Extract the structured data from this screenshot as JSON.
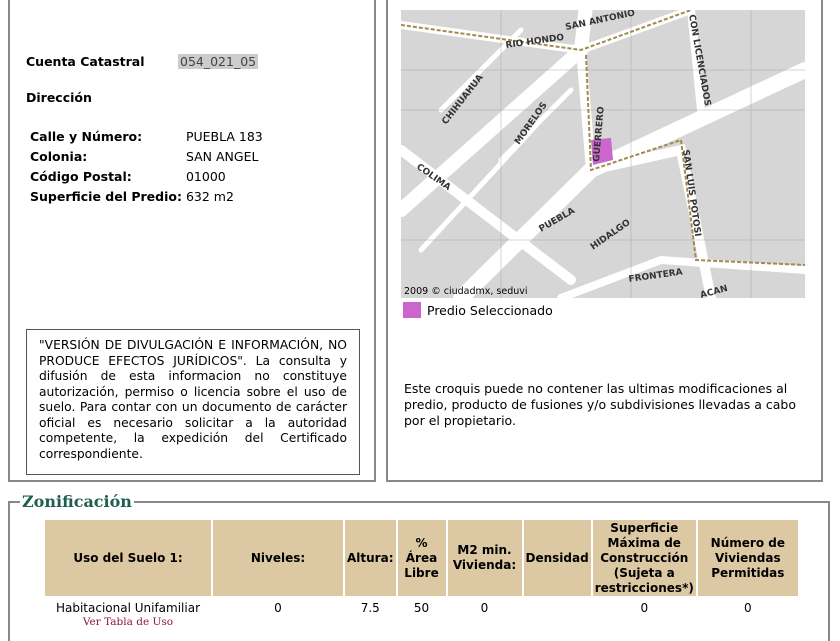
{
  "cuenta": {
    "label": "Cuenta Catastral",
    "value": "054_021_05"
  },
  "direccion": {
    "label": "Dirección",
    "rows": [
      {
        "label": "Calle y Número:",
        "value": "PUEBLA 183"
      },
      {
        "label": "Colonia:",
        "value": "SAN ANGEL"
      },
      {
        "label": "Código Postal:",
        "value": "01000"
      },
      {
        "label": "Superficie del Predio:",
        "value": "632 m2"
      }
    ]
  },
  "disclaimer": "\"VERSIÓN DE DIVULGACIÓN E INFORMACIÓN, NO PRODUCE EFECTOS JURÍDICOS\". La consulta y difusión de esta informacion no constituye autorización, permiso o licencia sobre el uso de suelo. Para contar con un documento de carácter oficial es necesario solicitar a la autoridad competente, la expedición del Certificado correspondiente.",
  "map": {
    "streets": [
      "SAN ANTONIO",
      "RIO HONDO",
      "CHIHUAHUA",
      "MORELOS",
      "GUERRERO",
      "CON LICENCIADOS",
      "COLIMA",
      "PUEBLA",
      "SAN LUIS POTOSI",
      "HIDALGO",
      "FRONTERA",
      "ACAN"
    ],
    "credit": "2009 © ciudadmx, seduvi",
    "highlight_color": "#cc66cc"
  },
  "legend": "Predio Seleccionado",
  "note": "Este croquis puede no contener las ultimas modificaciones al predio, producto de fusiones y/o subdivisiones llevadas a cabo por el propietario.",
  "zonificacion": {
    "title": "Zonificación",
    "headers": [
      "Uso del Suelo 1:",
      "Niveles:",
      "Altura:",
      "% Área Libre",
      "M2 min. Vivienda:",
      "Densidad",
      "Superficie Máxima de Construcción (Sujeta a restricciones*)",
      "Número de Viviendas Permitidas"
    ],
    "row": {
      "uso": "Habitacional Unifamiliar",
      "link": "Ver Tabla de Uso",
      "niveles": "0",
      "altura": "7.5",
      "area_libre": "50",
      "m2_min": "0",
      "densidad": "",
      "superficie": "0",
      "viviendas": "0"
    }
  }
}
